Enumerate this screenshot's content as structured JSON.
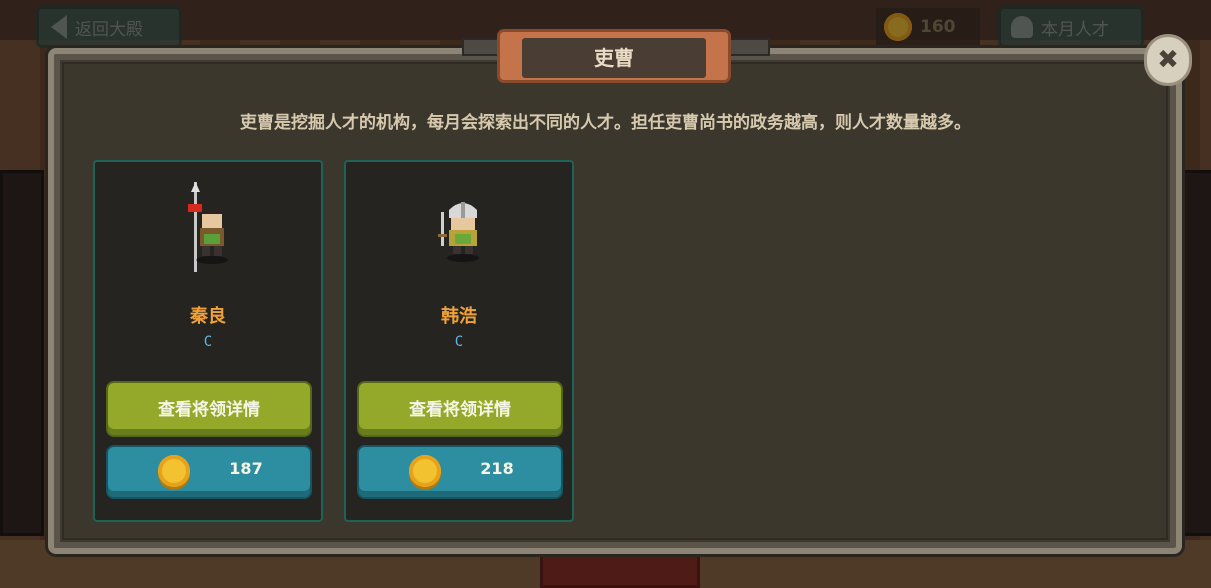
{
  "topbar": {
    "back_label": "返回大殿",
    "coins": "160",
    "talent_label": "本月人才"
  },
  "dialog": {
    "title": "吏曹",
    "description": "吏曹是挖掘人才的机构，每月会探索出不同的人才。担任吏曹尚书的政务越高，则人才数量越多。",
    "close_icon": "close-icon"
  },
  "cards": [
    {
      "name": "秦良",
      "grade": "C",
      "detail_label": "查看将领详情",
      "price": "187"
    },
    {
      "name": "韩浩",
      "grade": "C",
      "detail_label": "查看将领详情",
      "price": "218"
    }
  ],
  "colors": {
    "name": "#f0a23a",
    "grade": "#66b4e8",
    "detail_button": "#94a92a",
    "buy_button": "#2c8ea0"
  }
}
